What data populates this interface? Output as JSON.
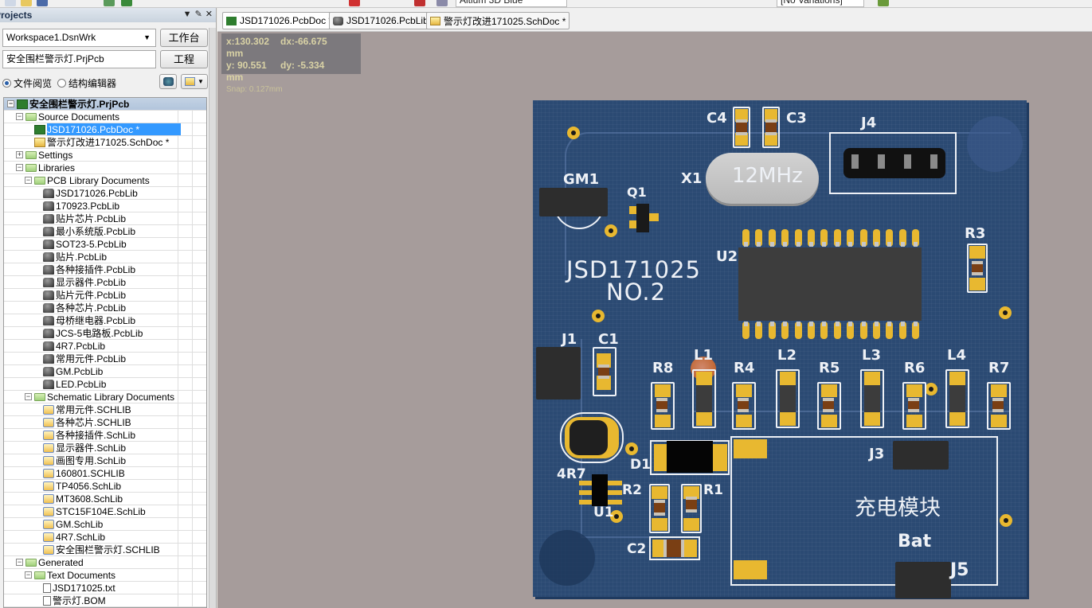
{
  "toolbar": {
    "view_mode": "Altium 3D Blue",
    "variants": "[No Variations]"
  },
  "panel": {
    "title": "Projects",
    "workspace_value": "Workspace1.DsnWrk",
    "workspace_button": "工作台",
    "project_value": "安全围栏警示灯.PrjPcb",
    "project_button": "工程",
    "radio_file_view": "文件阅览",
    "radio_structure_editor": "结构编辑器",
    "radio_selected": "file_view"
  },
  "tree": {
    "nodes": [
      {
        "label": "安全围栏警示灯.PrjPcb",
        "icon": "project-icon",
        "level": 0,
        "expander": "minus",
        "root": true
      },
      {
        "label": "Source Documents",
        "icon": "folder-icon",
        "level": 1,
        "expander": "minus"
      },
      {
        "label": "JSD171026.PcbDoc *",
        "icon": "pcbdoc-icon",
        "level": 2,
        "selected": true
      },
      {
        "label": "警示灯改进171025.SchDoc *",
        "icon": "schdoc-icon",
        "level": 2
      },
      {
        "label": "Settings",
        "icon": "folder-icon",
        "level": 1,
        "expander": "plus"
      },
      {
        "label": "Libraries",
        "icon": "folder-icon",
        "level": 1,
        "expander": "minus"
      },
      {
        "label": "PCB Library Documents",
        "icon": "folder-icon",
        "level": 2,
        "expander": "minus"
      },
      {
        "label": "JSD171026.PcbLib",
        "icon": "pcblib-icon",
        "level": 3
      },
      {
        "label": "170923.PcbLib",
        "icon": "pcblib-icon",
        "level": 3
      },
      {
        "label": "贴片芯片.PcbLib",
        "icon": "pcblib-icon",
        "level": 3
      },
      {
        "label": "最小系统版.PcbLib",
        "icon": "pcblib-icon",
        "level": 3
      },
      {
        "label": "SOT23-5.PcbLib",
        "icon": "pcblib-icon",
        "level": 3
      },
      {
        "label": "贴片.PcbLib",
        "icon": "pcblib-icon",
        "level": 3
      },
      {
        "label": "各种接插件.PcbLib",
        "icon": "pcblib-icon",
        "level": 3
      },
      {
        "label": "显示器件.PcbLib",
        "icon": "pcblib-icon",
        "level": 3
      },
      {
        "label": "贴片元件.PcbLib",
        "icon": "pcblib-icon",
        "level": 3
      },
      {
        "label": "各种芯片.PcbLib",
        "icon": "pcblib-icon",
        "level": 3
      },
      {
        "label": "母桥继电器.PcbLib",
        "icon": "pcblib-icon",
        "level": 3
      },
      {
        "label": "JCS-5电路板.PcbLib",
        "icon": "pcblib-icon",
        "level": 3
      },
      {
        "label": "4R7.PcbLib",
        "icon": "pcblib-icon",
        "level": 3
      },
      {
        "label": "常用元件.PcbLib",
        "icon": "pcblib-icon",
        "level": 3
      },
      {
        "label": "GM.PcbLib",
        "icon": "pcblib-icon",
        "level": 3
      },
      {
        "label": "LED.PcbLib",
        "icon": "pcblib-icon",
        "level": 3
      },
      {
        "label": "Schematic Library Documents",
        "icon": "folder-icon",
        "level": 2,
        "expander": "minus"
      },
      {
        "label": "常用元件.SCHLIB",
        "icon": "schlib-icon",
        "level": 3
      },
      {
        "label": "各种芯片.SCHLIB",
        "icon": "schlib-icon",
        "level": 3
      },
      {
        "label": "各种接插件.SchLib",
        "icon": "schlib-icon",
        "level": 3
      },
      {
        "label": "显示器件.SchLib",
        "icon": "schlib-icon",
        "level": 3
      },
      {
        "label": "画图专用.SchLib",
        "icon": "schlib-icon",
        "level": 3
      },
      {
        "label": "160801.SCHLIB",
        "icon": "schlib-icon",
        "level": 3
      },
      {
        "label": "TP4056.SchLib",
        "icon": "schlib-icon",
        "level": 3
      },
      {
        "label": "MT3608.SchLib",
        "icon": "schlib-icon",
        "level": 3
      },
      {
        "label": "STC15F104E.SchLib",
        "icon": "schlib-icon",
        "level": 3
      },
      {
        "label": "GM.SchLib",
        "icon": "schlib-icon",
        "level": 3
      },
      {
        "label": "4R7.SchLib",
        "icon": "schlib-icon",
        "level": 3
      },
      {
        "label": "安全围栏警示灯.SCHLIB",
        "icon": "schlib-icon",
        "level": 3
      },
      {
        "label": "Generated",
        "icon": "folder-icon",
        "level": 1,
        "expander": "minus"
      },
      {
        "label": "Text Documents",
        "icon": "folder-icon",
        "level": 2,
        "expander": "minus"
      },
      {
        "label": "JSD171025.txt",
        "icon": "text-file-icon",
        "level": 3
      },
      {
        "label": "警示灯.BOM",
        "icon": "text-file-icon",
        "level": 3
      }
    ]
  },
  "tabs": [
    {
      "label": "JSD171026.PcbDoc *",
      "icon": "pcbdoc-icon",
      "active": true
    },
    {
      "label": "JSD171026.PcbLib",
      "icon": "pcblib-icon",
      "active": false
    },
    {
      "label": "警示灯改进171025.SchDoc *",
      "icon": "schdoc-icon",
      "active": false
    }
  ],
  "hud": {
    "x": "x:130.302",
    "dx": "dx:-66.675",
    "y": "y: 90.551",
    "dy": "dy: -5.334",
    "unit": "mm",
    "snap": "Snap: 0.127mm"
  },
  "pcb": {
    "board_title": "JSD171025",
    "board_subtitle": "NO.2",
    "crystal_label": "12MHz",
    "charge_module_label": "充电模块",
    "battery_label": "Bat",
    "designators": {
      "C4": "C4",
      "C3": "C3",
      "J4": "J4",
      "X1": "X1",
      "GM1": "GM1",
      "Q1": "Q1",
      "U2": "U2",
      "R3": "R3",
      "J1": "J1",
      "C1": "C1",
      "L1": "L1",
      "R8": "R8",
      "R4": "R4",
      "L2": "L2",
      "R5": "R5",
      "L3": "L3",
      "R6": "R6",
      "L4": "L4",
      "R7": "R7",
      "J3": "J3",
      "D1": "D1",
      "4R7": "4R7",
      "R2": "R2",
      "R1": "R1",
      "U1": "U1",
      "C2": "C2",
      "J5": "J5"
    },
    "colors": {
      "board": "#2b4a73",
      "copper": "#e8b830",
      "silkscreen": "#eef1f6",
      "canvas": "#a69c9b"
    }
  }
}
